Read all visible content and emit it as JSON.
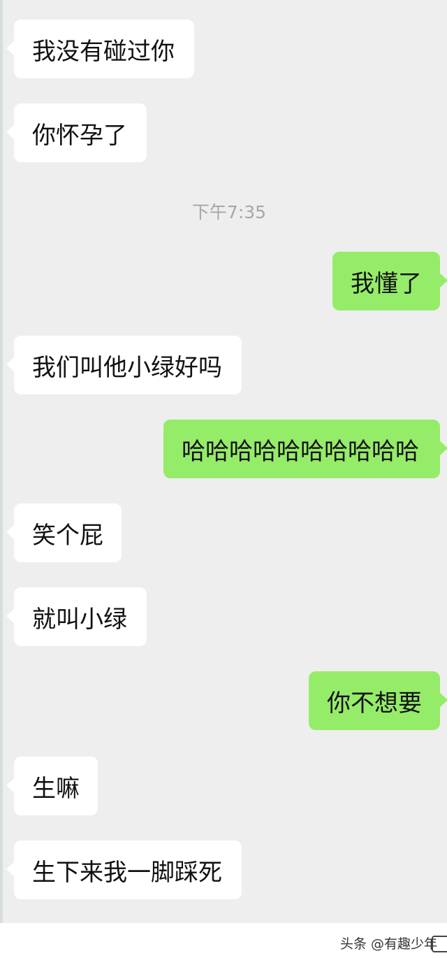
{
  "messages": [
    {
      "side": "left",
      "text": "我没有碰过你"
    },
    {
      "side": "left",
      "text": "你怀孕了"
    },
    {
      "side": "right",
      "text": "我懂了"
    },
    {
      "side": "left",
      "text": "我们叫他小绿好吗"
    },
    {
      "side": "right",
      "text": "哈哈哈哈哈哈哈哈哈哈"
    },
    {
      "side": "left",
      "text": "笑个屁"
    },
    {
      "side": "left",
      "text": "就叫小绿"
    },
    {
      "side": "right",
      "text": "你不想要"
    },
    {
      "side": "left",
      "text": "生嘛"
    },
    {
      "side": "left",
      "text": "生下来我一脚踩死"
    }
  ],
  "timestamp": "下午7:35",
  "watermark": "头条 @有趣少年",
  "colors": {
    "chat_background": "#eeeeee",
    "incoming_bubble": "#ffffff",
    "outgoing_bubble": "#95ec69"
  }
}
